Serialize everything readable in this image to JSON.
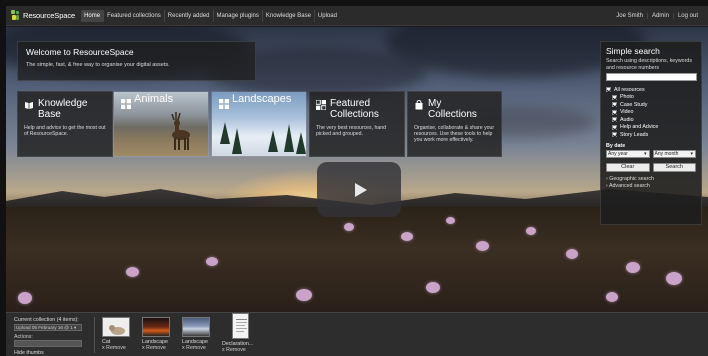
{
  "app": {
    "name": "ResourceSpace"
  },
  "nav": {
    "items": [
      "Home",
      "Featured collections",
      "Recently added",
      "Manage plugins",
      "Knowledge Base",
      "Upload"
    ],
    "user": [
      "Joe Smith",
      "Admin",
      "Log out"
    ]
  },
  "welcome": {
    "title": "Welcome to ResourceSpace",
    "subtitle": "The simple, fast, & free way to organise your digital assets."
  },
  "tiles": {
    "knowledge": {
      "title_line1": "Knowledge",
      "title_line2": "Base",
      "desc": "Help and advice to get the most out of ResourceSpace."
    },
    "animals": {
      "title": "Animals"
    },
    "landscapes": {
      "title": "Landscapes"
    },
    "featured": {
      "title_line1": "Featured",
      "title_line2": "Collections",
      "desc": "The very best resources, hand picked and grouped."
    },
    "my": {
      "title_line1": "My",
      "title_line2": "Collections",
      "desc": "Organise, collaborate & share your resources. Use these tools to help you work more effectively."
    }
  },
  "search": {
    "title": "Simple search",
    "desc": "Search using descriptions, keywords and resource numbers",
    "all_label": "All resources",
    "types": [
      "Photo",
      "Case Study",
      "Video",
      "Audio",
      "Help and Advice",
      "Story Leads"
    ],
    "by_date": "By date",
    "any_year": "Any year",
    "any_month": "Any month",
    "clear": "Clear",
    "search": "Search",
    "geo": "› Geographic search",
    "advanced": "› Advanced search"
  },
  "collection": {
    "current": "Current collection (4 items):",
    "upload_sel": "Upload 05 February 16 @ 1",
    "actions": "Actions:",
    "hide": "Hide thumbs",
    "items": [
      {
        "title": "Cat",
        "remove": "x Remove"
      },
      {
        "title": "Landscape",
        "remove": "x Remove"
      },
      {
        "title": "Landscape",
        "remove": "x Remove"
      },
      {
        "title": "Declaration...",
        "remove": "x Remove"
      }
    ]
  },
  "colors": {
    "topbar": "#2b2b2b",
    "panel": "#1e1e1e",
    "bottom": "#2d2d2d"
  }
}
